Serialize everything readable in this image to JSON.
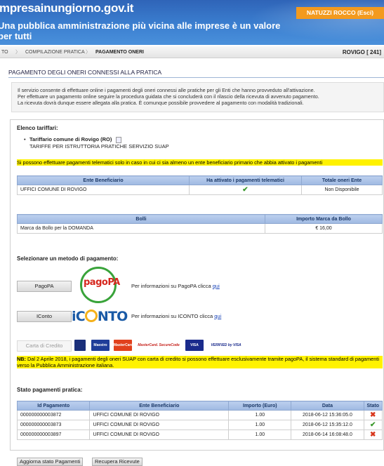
{
  "header": {
    "brand": "mpresainungiorno.gov.it",
    "tagline": "Una pubblica amministrazione più vicina alle imprese è un valore per tutti",
    "user_button": "NATUZZI ROCCO (Esci)"
  },
  "breadcrumb": {
    "items": [
      "TO",
      "COMPILAZIONE PRATICA",
      "PAGAMENTO ONERI"
    ],
    "code": "ROVIGO [ 241]"
  },
  "page_title": "PAGAMENTO DEGLI ONERI CONNESSI ALLA PRATICA",
  "intro": {
    "line1": "Il servizio consente di effettuare online i pagamenti degli oneri connessi alle pratiche per gli Enti che hanno provveduto all'attivazione.",
    "line2": "Per effettuare un pagamento online seguire la procedura guidata che si concluderà con il rilascio della ricevuta di avvenuto pagamento.",
    "line3": "La ricevuta dovrà dunque essere allegata alla pratica. È comunque possibile provvedere al pagamento con modalità tradizionali."
  },
  "tariffari": {
    "heading": "Elenco tariffari:",
    "item_title": "Tariffario comune di Rovigo (RO)",
    "item_sub": "TARIFFE PER ISTRUTTORIA PRATICHE SERVIZIO SUAP",
    "notice": "Si possono effettuare pagamenti telematici solo in caso in cui ci sia almeno un ente beneficiario primario che abbia attivato i pagamenti"
  },
  "enti_table": {
    "headers": [
      "Ente Beneficiario",
      "Ha attivato i pagamenti telematici",
      "Totale oneri Ente"
    ],
    "row": {
      "ente": "UFFICI COMUNE DI ROVIGO",
      "totale": "Non Disponibile"
    }
  },
  "bolli_table": {
    "headers": [
      "Bolli",
      "Importo Marca da Bollo"
    ],
    "row": {
      "bollo": "Marca da Bollo per la DOMANDA",
      "importo": "€ 16,00"
    }
  },
  "payment": {
    "heading": "Selezionare un metodo di pagamento:",
    "pagopa_label": "PagoPA",
    "pagopa_logo": "pagoPA",
    "pagopa_info": "Per informazioni su PagoPA clicca",
    "iconto_label": "IConto",
    "iconto_logo_a": "iC",
    "iconto_logo_b": "NTO",
    "iconto_info": "Per informazioni su ICONTO clicca",
    "link_text": "qui",
    "card_label": "Carta di Credito",
    "cards": [
      "Maestro",
      "MasterCard",
      "MasterCard. SecureCode",
      "VISA",
      "VERIFIED by VISA"
    ],
    "nb_prefix": "NB:",
    "nb_text": "Dal 2 Aprile 2018, i pagamenti degli oneri SUAP con carta di credito si possono effettuare esclusivamente tramite pagoPA, il sistema standard di pagamenti verso la Pubblica Amministrazione italiana."
  },
  "stato": {
    "heading": "Stato pagamenti pratica:",
    "headers": [
      "Id Pagamento",
      "Ente Beneficiario",
      "Importo (Euro)",
      "Data",
      "Stato"
    ],
    "rows": [
      {
        "id": "000000000003872",
        "ente": "UFFICI COMUNE DI ROVIGO",
        "importo": "1.00",
        "data": "2018-06-12 15:36:05.0",
        "stato": "error"
      },
      {
        "id": "000000000003873",
        "ente": "UFFICI COMUNE DI ROVIGO",
        "importo": "1.00",
        "data": "2018-06-12 15:35:12.0",
        "stato": "ok"
      },
      {
        "id": "000000000003897",
        "ente": "UFFICI COMUNE DI ROVIGO",
        "importo": "1.00",
        "data": "2018-06-14 16:08:48.0",
        "stato": "error"
      }
    ]
  },
  "buttons": {
    "aggiorna": "Aggiorna stato Pagamenti",
    "recupera": "Recupera Ricevute"
  },
  "colors": {
    "header_blue": "#3b7fd0",
    "orange": "#f39a1e",
    "notice_yellow": "#fff200",
    "ok_green": "#3d9a2f",
    "error_red": "#d8361c"
  }
}
